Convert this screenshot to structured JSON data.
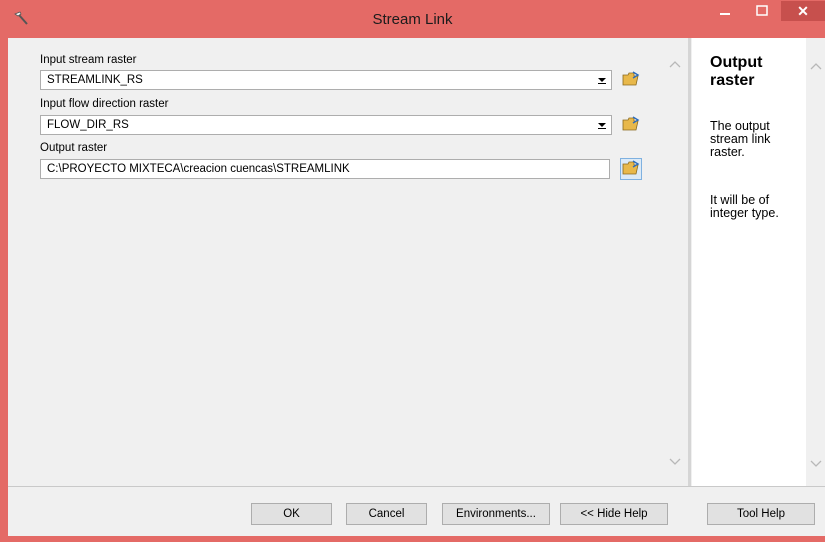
{
  "window": {
    "title": "Stream Link",
    "minimize": "–",
    "maximize": "□",
    "close": "✕"
  },
  "params": {
    "input_stream": {
      "label": "Input stream raster",
      "value": "STREAMLINK_RS"
    },
    "input_flowdir": {
      "label": "Input flow direction raster",
      "value": "FLOW_DIR_RS"
    },
    "output": {
      "label": "Output raster",
      "value": "C:\\PROYECTO MIXTECA\\creacion cuencas\\STREAMLINK"
    }
  },
  "help": {
    "title": "Output raster",
    "p1": "The output stream link raster.",
    "p2": "It will be of integer type."
  },
  "buttons": {
    "ok": "OK",
    "cancel": "Cancel",
    "environments": "Environments...",
    "hide_help": "<< Hide Help",
    "tool_help": "Tool Help"
  },
  "icons": {
    "title": "hammer-icon",
    "browse": "open-folder-icon",
    "dropdown": "chevron-down-icon",
    "scroll_up": "chevron-up-icon",
    "scroll_down": "chevron-down-icon"
  },
  "colors": {
    "titlebar": "#e46a66",
    "close_button": "#c7504d",
    "folder": "#e8b84a"
  }
}
